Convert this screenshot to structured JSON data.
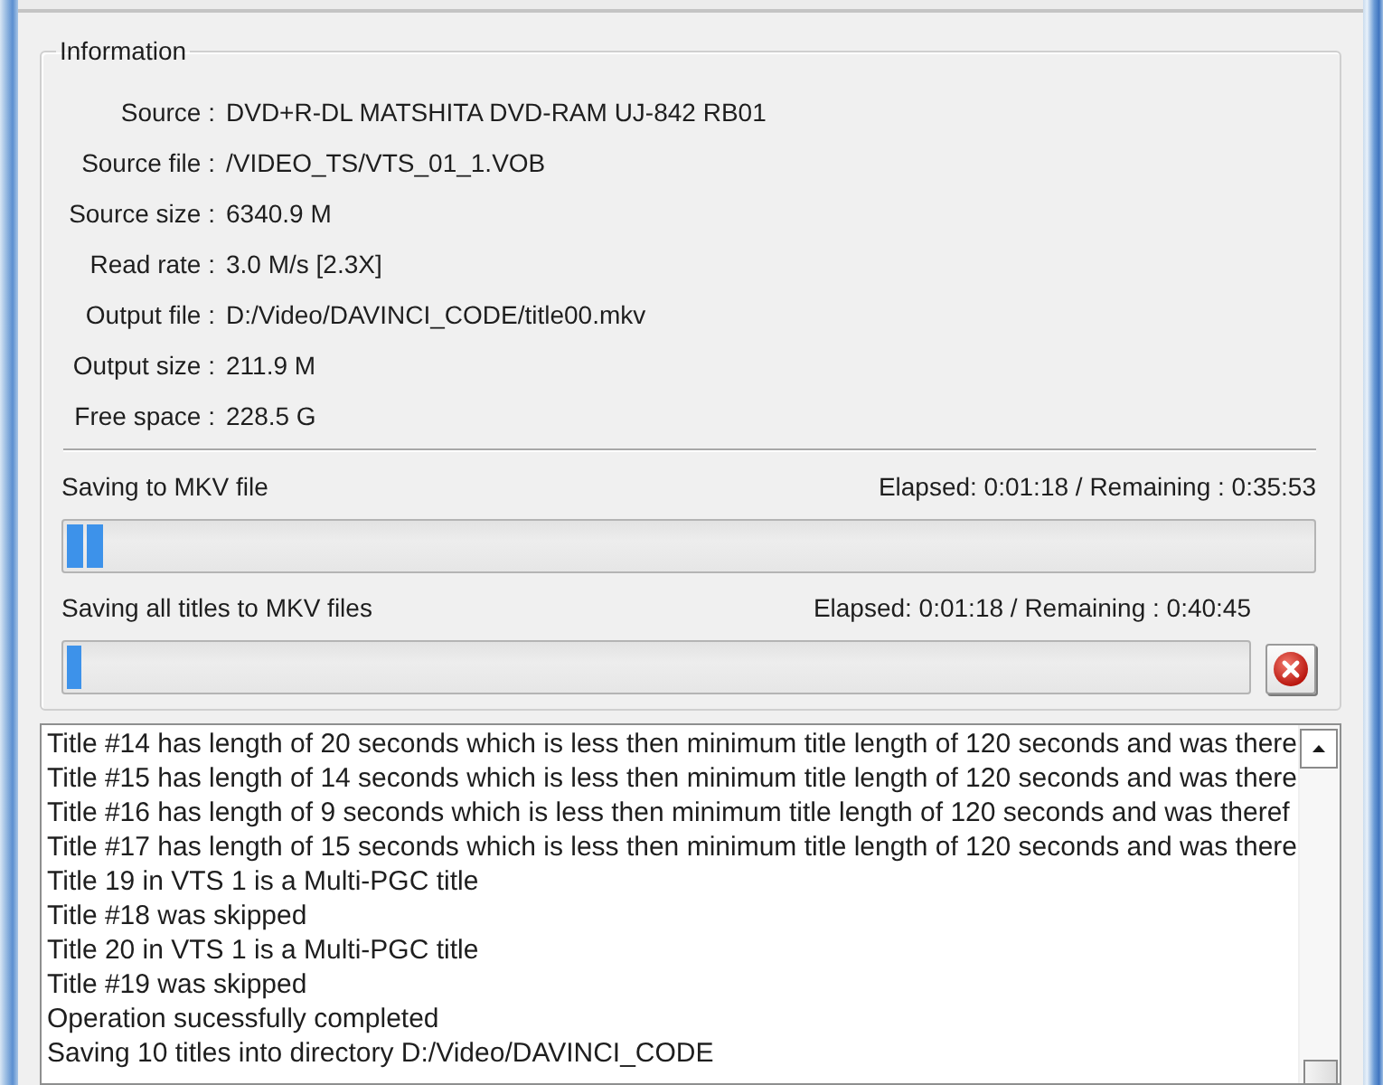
{
  "information": {
    "title": "Information",
    "fields": [
      {
        "label": "Source :",
        "value": "DVD+R-DL MATSHITA DVD-RAM UJ-842 RB01"
      },
      {
        "label": "Source file :",
        "value": "/VIDEO_TS/VTS_01_1.VOB"
      },
      {
        "label": "Source size :",
        "value": "6340.9 M"
      },
      {
        "label": "Read rate :",
        "value": "3.0 M/s [2.3X]"
      },
      {
        "label": "Output file :",
        "value": "D:/Video/DAVINCI_CODE/title00.mkv"
      },
      {
        "label": "Output size :",
        "value": "211.9 M"
      },
      {
        "label": "Free space :",
        "value": "228.5 G"
      }
    ]
  },
  "progress": [
    {
      "kind": "plain",
      "label": "Saving to MKV file",
      "time": "Elapsed: 0:01:18 / Remaining : 0:35:53",
      "level": 0.032
    },
    {
      "kind": "cancelable",
      "label": "Saving all titles to MKV files",
      "time": "Elapsed: 0:01:18 / Remaining : 0:40:45",
      "level": 0.012
    }
  ],
  "log": {
    "lines": [
      "Title #14 has length of 20 seconds which is less then minimum title length of 120 seconds and was there",
      "Title #15 has length of 14 seconds which is less then minimum title length of 120 seconds and was there",
      "Title #16 has length of 9 seconds which is less then minimum title length of 120 seconds and was theref",
      "Title #17 has length of 15 seconds which is less then minimum title length of 120 seconds and was there",
      "Title 19 in VTS 1 is a Multi-PGC title",
      "Title #18 was skipped",
      "Title 20 in VTS 1 is a Multi-PGC title",
      "Title #19 was skipped",
      "Operation sucessfully completed",
      "Saving 10 titles into directory D:/Video/DAVINCI_CODE"
    ]
  }
}
